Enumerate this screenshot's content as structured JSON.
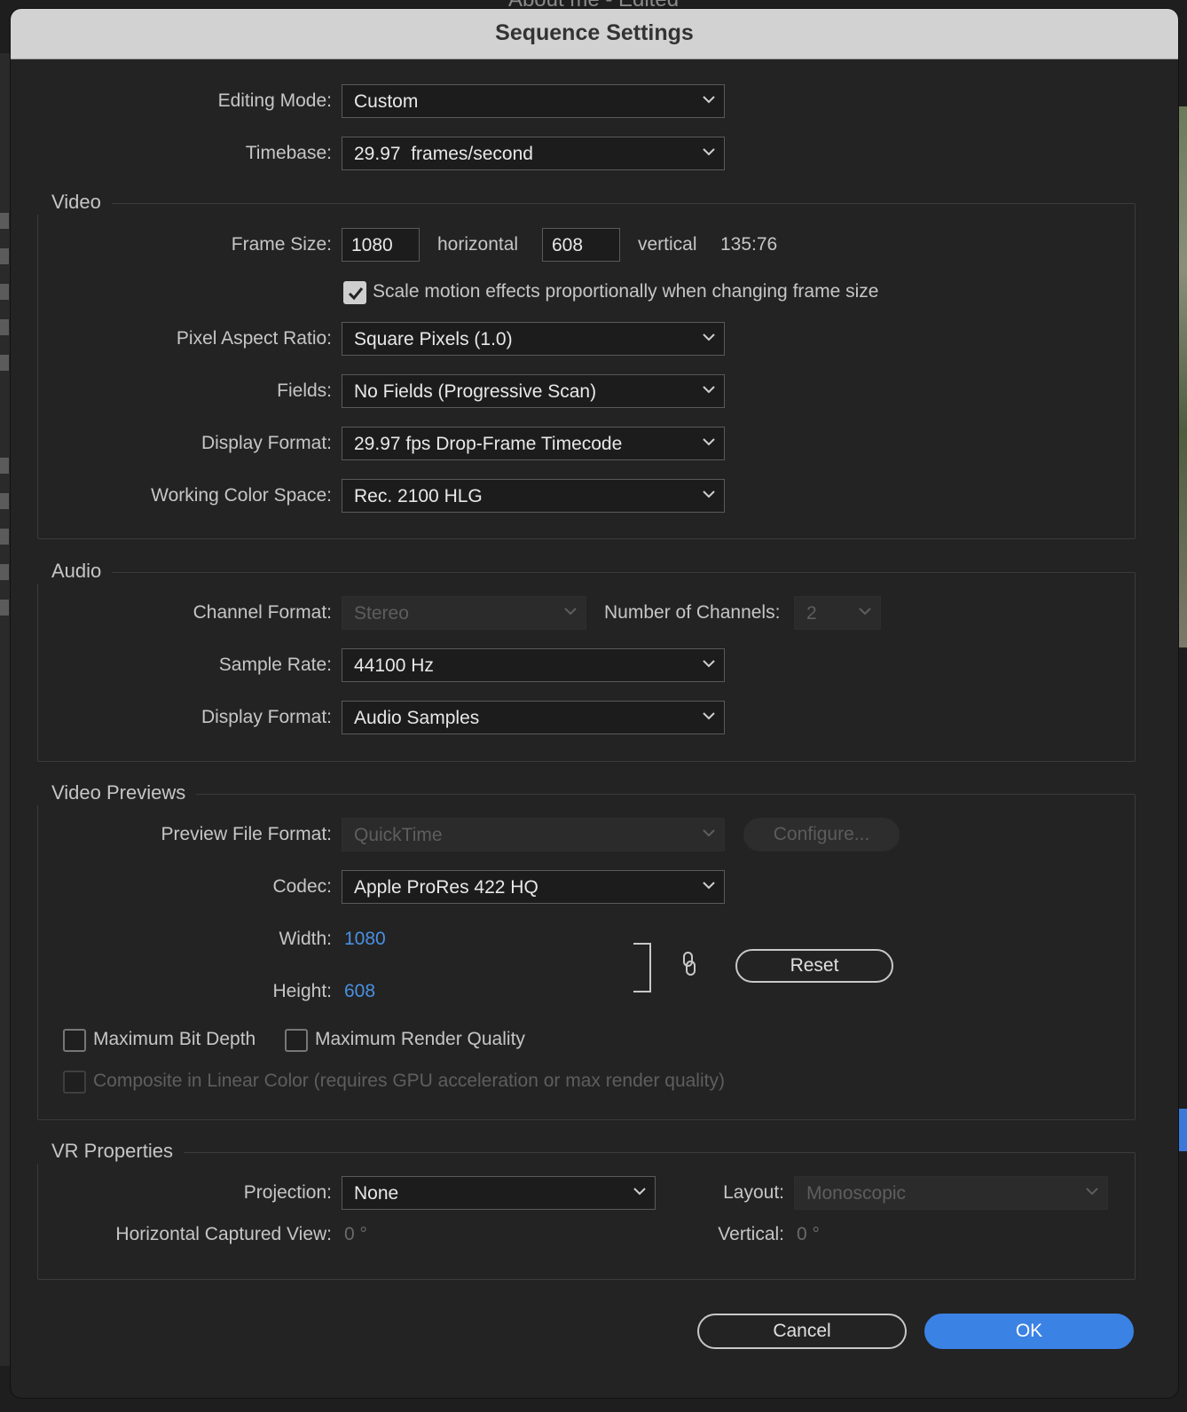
{
  "background": {
    "window_title": "About me - Edited"
  },
  "dialog": {
    "title": "Sequence Settings"
  },
  "editing_mode": {
    "label": "Editing Mode:",
    "value": "Custom"
  },
  "timebase": {
    "label": "Timebase:",
    "value": "29.97  frames/second"
  },
  "video": {
    "title": "Video",
    "frame_size_label": "Frame Size:",
    "frame_width": "1080",
    "horizontal_label": "horizontal",
    "frame_height": "608",
    "vertical_label": "vertical",
    "aspect": "135:76",
    "scale_motion_label": "Scale motion effects proportionally when changing frame size",
    "scale_motion_checked": true,
    "pixel_aspect": {
      "label": "Pixel Aspect Ratio:",
      "value": "Square Pixels (1.0)"
    },
    "fields": {
      "label": "Fields:",
      "value": "No Fields (Progressive Scan)"
    },
    "display_format": {
      "label": "Display Format:",
      "value": "29.97 fps Drop-Frame Timecode"
    },
    "color_space": {
      "label": "Working Color Space:",
      "value": "Rec. 2100 HLG"
    }
  },
  "audio": {
    "title": "Audio",
    "channel_format": {
      "label": "Channel Format:",
      "value": "Stereo"
    },
    "num_channels": {
      "label": "Number of Channels:",
      "value": "2"
    },
    "sample_rate": {
      "label": "Sample Rate:",
      "value": "44100 Hz"
    },
    "display_format": {
      "label": "Display Format:",
      "value": "Audio Samples"
    }
  },
  "previews": {
    "title": "Video Previews",
    "file_format": {
      "label": "Preview File Format:",
      "value": "QuickTime"
    },
    "configure_label": "Configure...",
    "codec": {
      "label": "Codec:",
      "value": "Apple ProRes 422 HQ"
    },
    "width": {
      "label": "Width:",
      "value": "1080"
    },
    "height": {
      "label": "Height:",
      "value": "608"
    },
    "reset_label": "Reset",
    "max_bit_depth": "Maximum Bit Depth",
    "max_render_quality": "Maximum Render Quality",
    "composite_linear": "Composite in Linear Color (requires GPU acceleration or max render quality)"
  },
  "vr": {
    "title": "VR Properties",
    "projection": {
      "label": "Projection:",
      "value": "None"
    },
    "layout": {
      "label": "Layout:",
      "value": "Monoscopic"
    },
    "h_view": {
      "label": "Horizontal Captured View:",
      "value": "0 °"
    },
    "vertical": {
      "label": "Vertical:",
      "value": "0 °"
    }
  },
  "buttons": {
    "cancel": "Cancel",
    "ok": "OK"
  },
  "icons": [
    "chevron-down-icon",
    "checkmark-icon",
    "link-icon"
  ]
}
